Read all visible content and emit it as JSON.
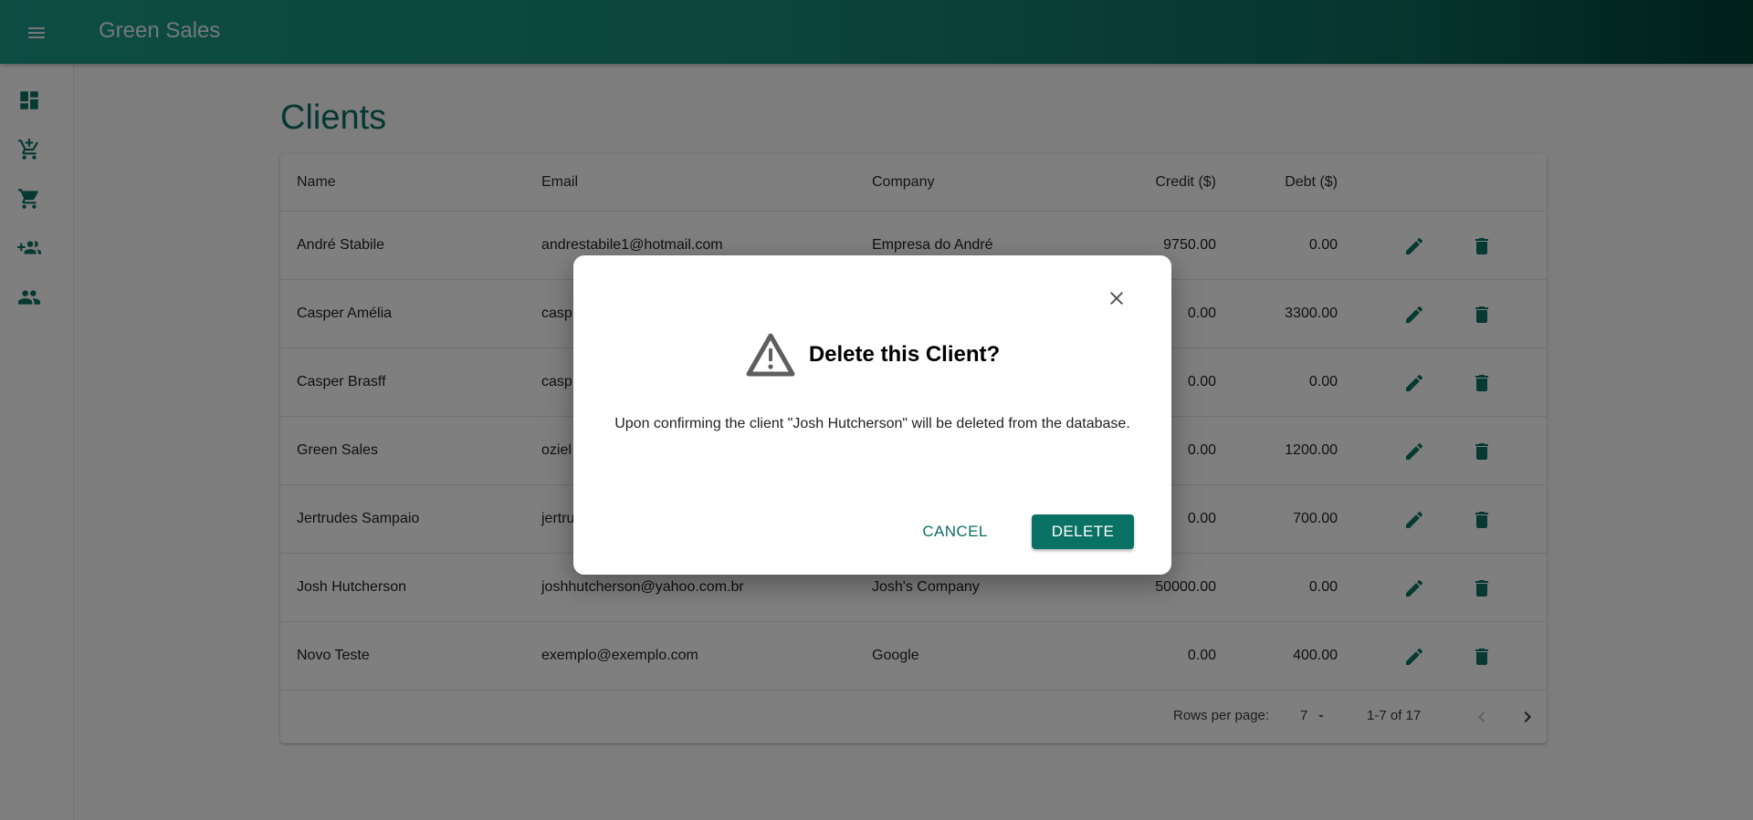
{
  "app": {
    "title": "Green Sales"
  },
  "sidebar": {
    "items": [
      {
        "name": "dashboard",
        "icon": "dashboard-icon"
      },
      {
        "name": "add-to-cart",
        "icon": "add-shopping-cart-icon"
      },
      {
        "name": "cart",
        "icon": "shopping-cart-icon"
      },
      {
        "name": "add-client",
        "icon": "group-add-icon"
      },
      {
        "name": "clients",
        "icon": "people-icon"
      }
    ]
  },
  "page": {
    "title": "Clients"
  },
  "table": {
    "columns": [
      "Name",
      "Email",
      "Company",
      "Credit ($)",
      "Debt ($)"
    ],
    "rows": [
      {
        "name": "André Stabile",
        "email": "andrestabile1@hotmail.com",
        "company": "Empresa do André",
        "credit": "9750.00",
        "debt": "0.00"
      },
      {
        "name": "Casper Amélia",
        "email": "casp",
        "company": "",
        "credit": "0.00",
        "debt": "3300.00"
      },
      {
        "name": "Casper Brasff",
        "email": "casp",
        "company": "",
        "credit": "0.00",
        "debt": "0.00"
      },
      {
        "name": "Green Sales",
        "email": "oziel",
        "company": "",
        "credit": "0.00",
        "debt": "1200.00"
      },
      {
        "name": "Jertrudes Sampaio",
        "email": "jertru",
        "company": "",
        "credit": "0.00",
        "debt": "700.00"
      },
      {
        "name": "Josh Hutcherson",
        "email": "joshhutcherson@yahoo.com.br",
        "company": "Josh's Company",
        "credit": "50000.00",
        "debt": "0.00"
      },
      {
        "name": "Novo Teste",
        "email": "exemplo@exemplo.com",
        "company": "Google",
        "credit": "0.00",
        "debt": "400.00"
      }
    ]
  },
  "pagination": {
    "rows_per_page_label": "Rows per page:",
    "rows_per_page": "7",
    "range": "1-7 of 17"
  },
  "dialog": {
    "title": "Delete this Client?",
    "message": "Upon confirming the client \"Josh Hutcherson\" will be deleted from the database.",
    "cancel_label": "CANCEL",
    "delete_label": "DELETE"
  },
  "colors": {
    "primary": "#0a7265",
    "appbar_start": "#1b9a88",
    "appbar_end": "#003f33"
  }
}
